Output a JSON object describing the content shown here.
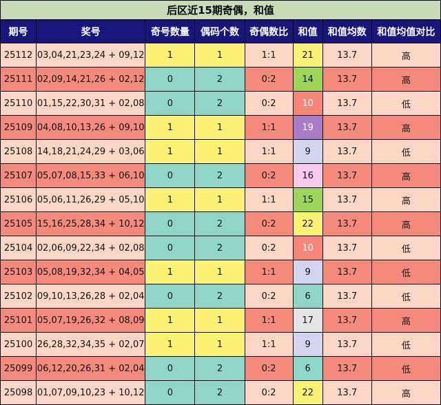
{
  "title": "后区近15期奇偶，和值",
  "headers": [
    "期号",
    "奖号",
    "奇号数量",
    "偶码个数",
    "奇偶数比",
    "和值",
    "和值均数",
    "和值均值对比"
  ],
  "colors": {
    "title_bg": "#c9dbb6",
    "header_bg": "#1a147d",
    "row_pink": "#fcd6c5",
    "row_salmon": "#f48a7c",
    "odd_yellow": "#fbf276",
    "odd_teal": "#8fd6c8",
    "ratio_pink": "#fcd6c5",
    "ratio_salmon": "#f48a7c"
  },
  "rows": [
    {
      "issue": "25112",
      "numbers": "03,04,21,23,24 + 09,12",
      "odd_count": "1",
      "even_count": "1",
      "ratio": "1:1",
      "sum": "21",
      "avg": "13.7",
      "cmp": "高",
      "row_bg": "#fcd6c5",
      "oe_bg": "#fbf276",
      "ratio_bg": "#fcd6c5",
      "sum_bg": "#fbf276",
      "sum_color": "#111111",
      "cmp_bg": "#fcd6c5"
    },
    {
      "issue": "25111",
      "numbers": "02,09,14,21,26 + 02,12",
      "odd_count": "0",
      "even_count": "2",
      "ratio": "0:2",
      "sum": "14",
      "avg": "13.7",
      "cmp": "高",
      "row_bg": "#f48a7c",
      "oe_bg": "#8fd6c8",
      "ratio_bg": "#f48a7c",
      "sum_bg": "#9fd65a",
      "sum_color": "#111111",
      "cmp_bg": "#f48a7c"
    },
    {
      "issue": "25110",
      "numbers": "01,15,22,30,31 + 02,08",
      "odd_count": "0",
      "even_count": "2",
      "ratio": "0:2",
      "sum": "10",
      "avg": "13.7",
      "cmp": "低",
      "row_bg": "#fcd6c5",
      "oe_bg": "#8fd6c8",
      "ratio_bg": "#fcd6c5",
      "sum_bg": "#f6867a",
      "sum_color": "#ffffff",
      "cmp_bg": "#fcd6c5"
    },
    {
      "issue": "25109",
      "numbers": "04,08,10,13,26 + 09,10",
      "odd_count": "1",
      "even_count": "1",
      "ratio": "1:1",
      "sum": "19",
      "avg": "13.7",
      "cmp": "高",
      "row_bg": "#f48a7c",
      "oe_bg": "#fbf276",
      "ratio_bg": "#f48a7c",
      "sum_bg": "#a97bc9",
      "sum_color": "#ffffff",
      "cmp_bg": "#f48a7c"
    },
    {
      "issue": "25108",
      "numbers": "14,18,21,24,29 + 03,06",
      "odd_count": "1",
      "even_count": "1",
      "ratio": "1:1",
      "sum": "9",
      "avg": "13.7",
      "cmp": "低",
      "row_bg": "#fcd6c5",
      "oe_bg": "#fbf276",
      "ratio_bg": "#fcd6c5",
      "sum_bg": "#d3d5ee",
      "sum_color": "#111111",
      "cmp_bg": "#fcd6c5"
    },
    {
      "issue": "25107",
      "numbers": "05,07,08,15,33 + 06,10",
      "odd_count": "0",
      "even_count": "2",
      "ratio": "0:2",
      "sum": "16",
      "avg": "13.7",
      "cmp": "高",
      "row_bg": "#f48a7c",
      "oe_bg": "#8fd6c8",
      "ratio_bg": "#f48a7c",
      "sum_bg": "#f8c9ec",
      "sum_color": "#111111",
      "cmp_bg": "#f48a7c"
    },
    {
      "issue": "25106",
      "numbers": "05,06,11,26,29 + 05,10",
      "odd_count": "1",
      "even_count": "1",
      "ratio": "1:1",
      "sum": "15",
      "avg": "13.7",
      "cmp": "高",
      "row_bg": "#fcd6c5",
      "oe_bg": "#fbf276",
      "ratio_bg": "#fcd6c5",
      "sum_bg": "#9fd65a",
      "sum_color": "#111111",
      "cmp_bg": "#fcd6c5"
    },
    {
      "issue": "25105",
      "numbers": "15,16,25,28,34 + 10,12",
      "odd_count": "0",
      "even_count": "2",
      "ratio": "0:2",
      "sum": "22",
      "avg": "13.7",
      "cmp": "高",
      "row_bg": "#f48a7c",
      "oe_bg": "#8fd6c8",
      "ratio_bg": "#f48a7c",
      "sum_bg": "#fbf276",
      "sum_color": "#111111",
      "cmp_bg": "#f48a7c"
    },
    {
      "issue": "25104",
      "numbers": "02,06,09,22,34 + 02,08",
      "odd_count": "0",
      "even_count": "2",
      "ratio": "0:2",
      "sum": "10",
      "avg": "13.7",
      "cmp": "低",
      "row_bg": "#fcd6c5",
      "oe_bg": "#8fd6c8",
      "ratio_bg": "#fcd6c5",
      "sum_bg": "#f6867a",
      "sum_color": "#ffffff",
      "cmp_bg": "#fcd6c5"
    },
    {
      "issue": "25103",
      "numbers": "05,08,19,32,34 + 04,05",
      "odd_count": "1",
      "even_count": "1",
      "ratio": "1:1",
      "sum": "9",
      "avg": "13.7",
      "cmp": "低",
      "row_bg": "#f48a7c",
      "oe_bg": "#fbf276",
      "ratio_bg": "#f48a7c",
      "sum_bg": "#d3d5ee",
      "sum_color": "#111111",
      "cmp_bg": "#f48a7c"
    },
    {
      "issue": "25102",
      "numbers": "09,10,13,26,28 + 02,04",
      "odd_count": "0",
      "even_count": "2",
      "ratio": "0:2",
      "sum": "6",
      "avg": "13.7",
      "cmp": "低",
      "row_bg": "#fcd6c5",
      "oe_bg": "#8fd6c8",
      "ratio_bg": "#fcd6c5",
      "sum_bg": "#8fd6c8",
      "sum_color": "#111111",
      "cmp_bg": "#fcd6c5"
    },
    {
      "issue": "25101",
      "numbers": "05,07,19,26,32 + 08,09",
      "odd_count": "1",
      "even_count": "1",
      "ratio": "1:1",
      "sum": "17",
      "avg": "13.7",
      "cmp": "高",
      "row_bg": "#f48a7c",
      "oe_bg": "#fbf276",
      "ratio_bg": "#f48a7c",
      "sum_bg": "#e4e4e4",
      "sum_color": "#111111",
      "cmp_bg": "#f48a7c"
    },
    {
      "issue": "25100",
      "numbers": "26,28,32,34,35 + 02,07",
      "odd_count": "1",
      "even_count": "1",
      "ratio": "1:1",
      "sum": "9",
      "avg": "13.7",
      "cmp": "低",
      "row_bg": "#fcd6c5",
      "oe_bg": "#fbf276",
      "ratio_bg": "#fcd6c5",
      "sum_bg": "#d3d5ee",
      "sum_color": "#111111",
      "cmp_bg": "#fcd6c5"
    },
    {
      "issue": "25099",
      "numbers": "06,12,20,26,31 + 02,04",
      "odd_count": "0",
      "even_count": "2",
      "ratio": "0:2",
      "sum": "6",
      "avg": "13.7",
      "cmp": "低",
      "row_bg": "#f48a7c",
      "oe_bg": "#8fd6c8",
      "ratio_bg": "#f48a7c",
      "sum_bg": "#8fd6c8",
      "sum_color": "#111111",
      "cmp_bg": "#f48a7c"
    },
    {
      "issue": "25098",
      "numbers": "01,07,09,10,23 + 10,12",
      "odd_count": "0",
      "even_count": "2",
      "ratio": "0:2",
      "sum": "22",
      "avg": "13.7",
      "cmp": "高",
      "row_bg": "#fcd6c5",
      "oe_bg": "#8fd6c8",
      "ratio_bg": "#fcd6c5",
      "sum_bg": "#fbf276",
      "sum_color": "#111111",
      "cmp_bg": "#fcd6c5"
    }
  ]
}
